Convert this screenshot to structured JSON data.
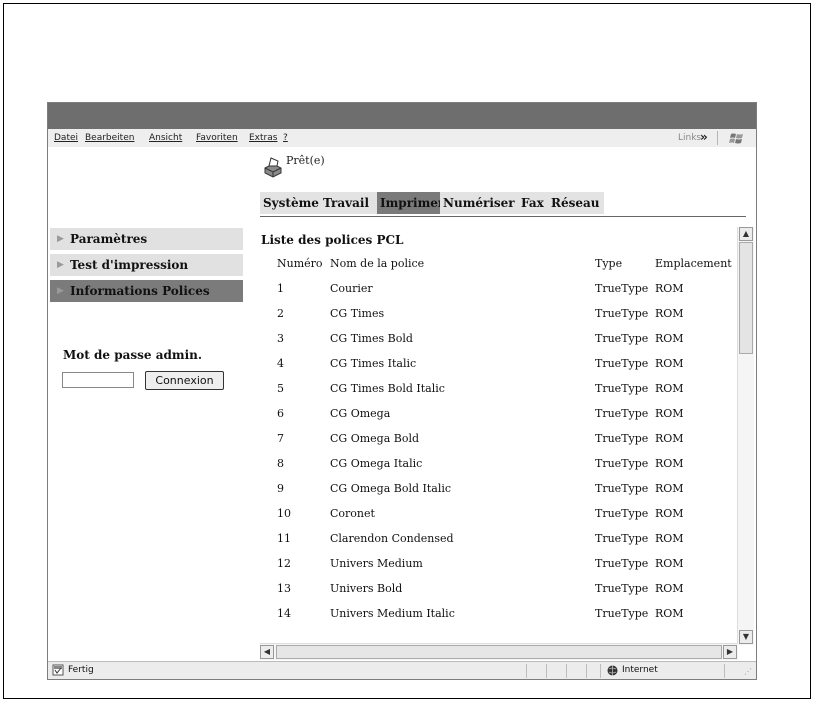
{
  "menu": {
    "items": [
      "Datei",
      "Bearbeiten",
      "Ansicht",
      "Favoriten",
      "Extras",
      "?"
    ],
    "links_label": "Links",
    "chevron": "»"
  },
  "header": {
    "status_text": "Prêt(e)"
  },
  "tabs": [
    {
      "label": "Système",
      "active": false
    },
    {
      "label": "Travail",
      "active": false
    },
    {
      "label": "Imprimer",
      "active": true
    },
    {
      "label": "Numériser",
      "active": false
    },
    {
      "label": "Fax",
      "active": false
    },
    {
      "label": "Réseau",
      "active": false
    }
  ],
  "sidebar": {
    "items": [
      {
        "label": "Paramètres",
        "active": false
      },
      {
        "label": "Test d'impression",
        "active": false
      },
      {
        "label": "Informations Polices",
        "active": true
      }
    ],
    "admin_label": "Mot de passe admin.",
    "password_value": "",
    "login_button": "Connexion"
  },
  "main": {
    "list_title": "Liste des polices PCL",
    "columns": [
      "Numéro",
      "Nom de la police",
      "Type",
      "Emplacement"
    ],
    "rows": [
      {
        "num": "1",
        "name": "Courier",
        "type": "TrueType",
        "location": "ROM"
      },
      {
        "num": "2",
        "name": "CG Times",
        "type": "TrueType",
        "location": "ROM"
      },
      {
        "num": "3",
        "name": "CG Times Bold",
        "type": "TrueType",
        "location": "ROM"
      },
      {
        "num": "4",
        "name": "CG Times Italic",
        "type": "TrueType",
        "location": "ROM"
      },
      {
        "num": "5",
        "name": "CG Times Bold Italic",
        "type": "TrueType",
        "location": "ROM"
      },
      {
        "num": "6",
        "name": "CG Omega",
        "type": "TrueType",
        "location": "ROM"
      },
      {
        "num": "7",
        "name": "CG Omega Bold",
        "type": "TrueType",
        "location": "ROM"
      },
      {
        "num": "8",
        "name": "CG Omega Italic",
        "type": "TrueType",
        "location": "ROM"
      },
      {
        "num": "9",
        "name": "CG Omega Bold Italic",
        "type": "TrueType",
        "location": "ROM"
      },
      {
        "num": "10",
        "name": "Coronet",
        "type": "TrueType",
        "location": "ROM"
      },
      {
        "num": "11",
        "name": "Clarendon Condensed",
        "type": "TrueType",
        "location": "ROM"
      },
      {
        "num": "12",
        "name": "Univers Medium",
        "type": "TrueType",
        "location": "ROM"
      },
      {
        "num": "13",
        "name": "Univers Bold",
        "type": "TrueType",
        "location": "ROM"
      },
      {
        "num": "14",
        "name": "Univers Medium Italic",
        "type": "TrueType",
        "location": "ROM"
      }
    ]
  },
  "statusbar": {
    "left_text": "Fertig",
    "zone_text": "Internet"
  }
}
